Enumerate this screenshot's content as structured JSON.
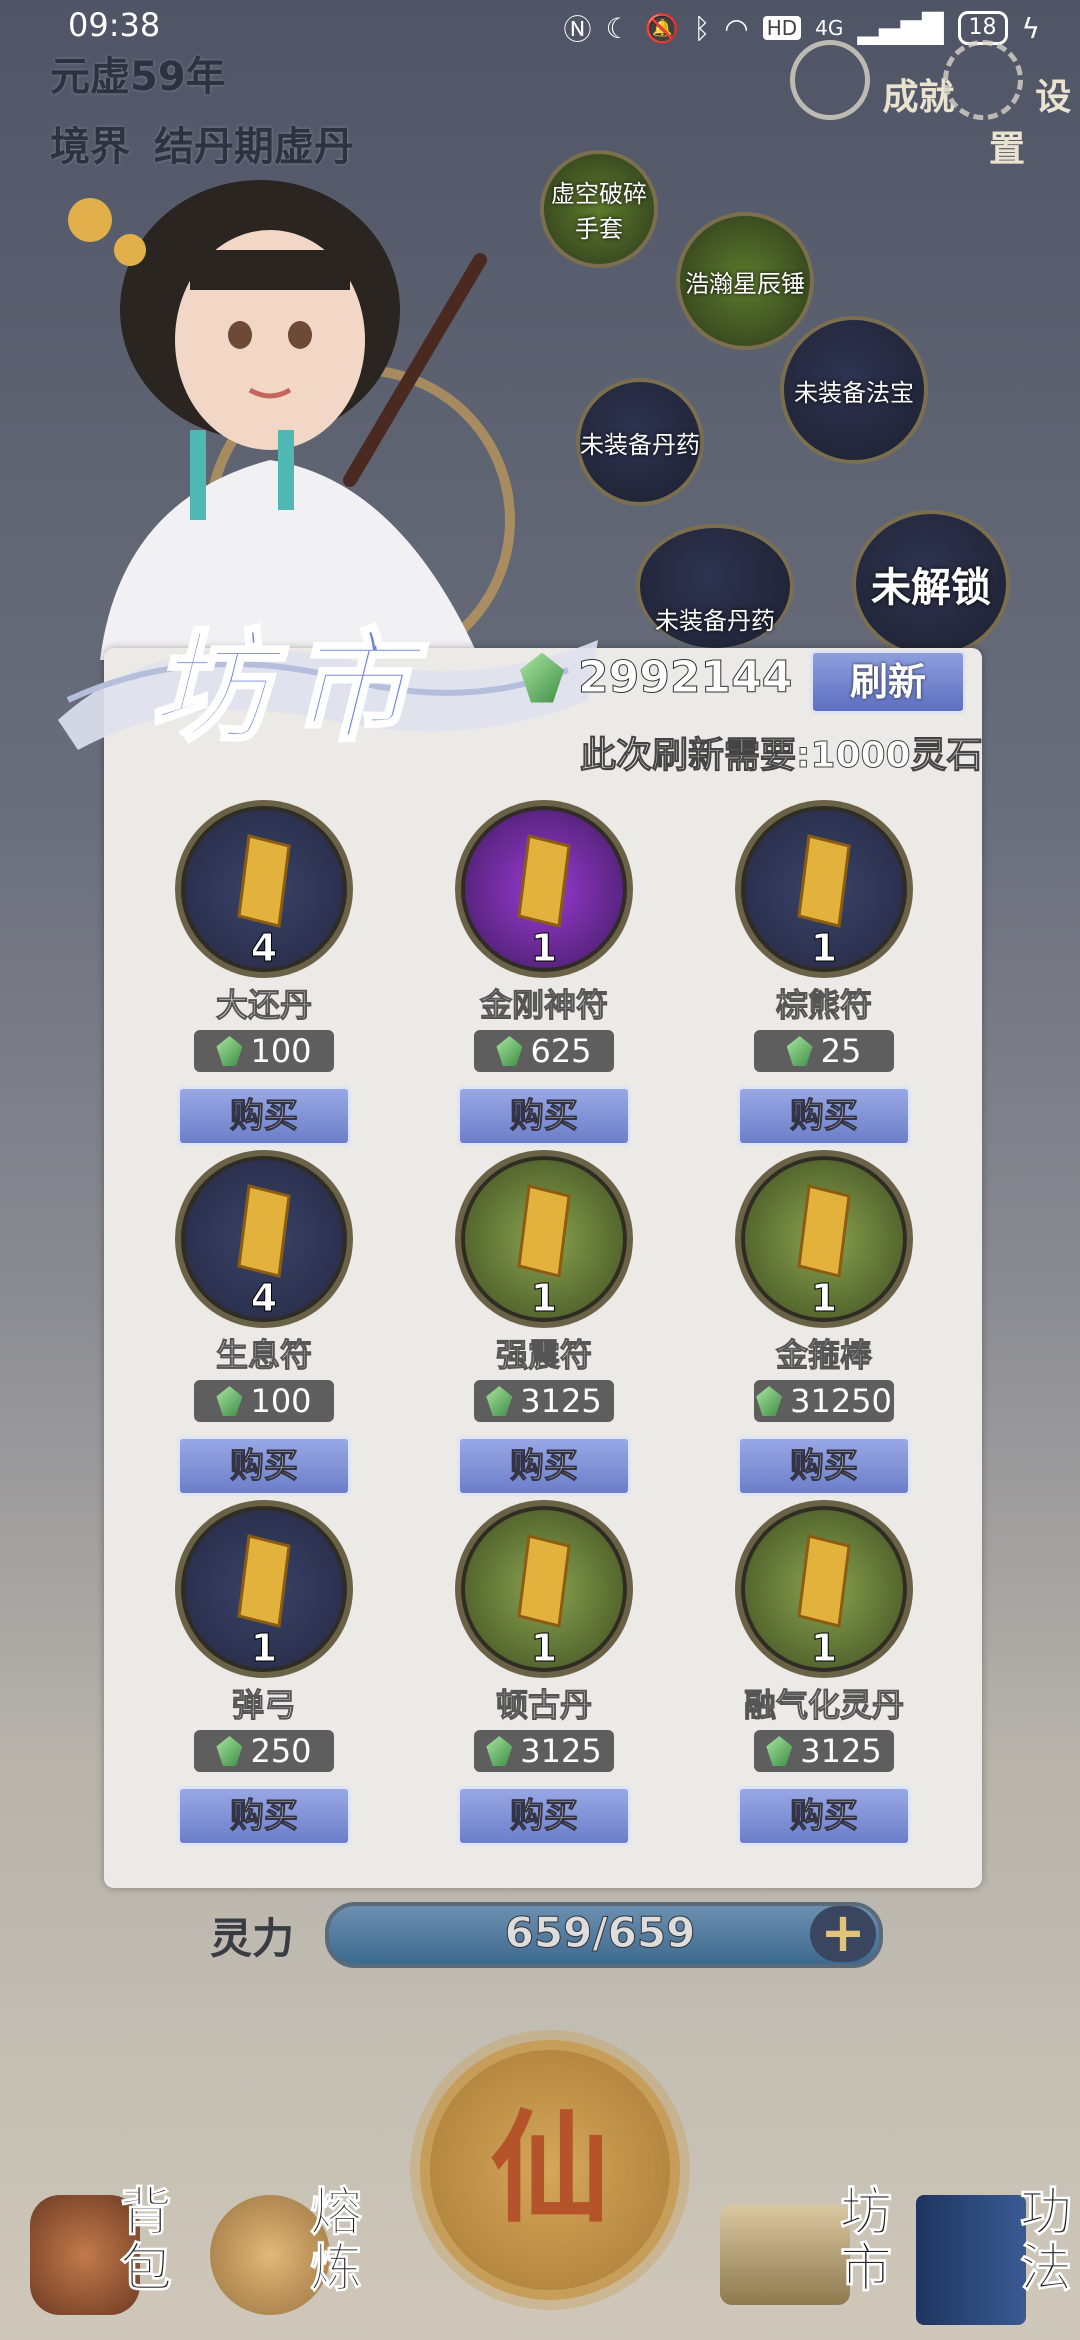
{
  "status_bar": {
    "time": "09:38",
    "network": "4G",
    "battery": "18"
  },
  "header": {
    "year": "元虚59年",
    "realm_label": "境界",
    "realm_value": "结丹期虚丹"
  },
  "top_buttons": {
    "achievements": "成就",
    "settings": "设置"
  },
  "equipment": [
    {
      "label": "虚空破碎手套"
    },
    {
      "label": "浩瀚星辰锤"
    },
    {
      "label": "未装备法宝"
    },
    {
      "label": "未装备丹药"
    },
    {
      "label": "未装备丹药"
    },
    {
      "label": "未解锁"
    }
  ],
  "market": {
    "title": "坊市",
    "spirit_stones": "2992144",
    "refresh_label": "刷新",
    "refresh_cost": "此次刷新需要:1000灵石",
    "buy_label": "购买",
    "items": [
      {
        "name": "大还丹",
        "qty": "4",
        "price": "100",
        "bg": "blue"
      },
      {
        "name": "金刚神符",
        "qty": "1",
        "price": "625",
        "bg": "purple"
      },
      {
        "name": "棕熊符",
        "qty": "1",
        "price": "25",
        "bg": "blue"
      },
      {
        "name": "生息符",
        "qty": "4",
        "price": "100",
        "bg": "blue"
      },
      {
        "name": "强震符",
        "qty": "1",
        "price": "3125",
        "bg": "green"
      },
      {
        "name": "金箍棒",
        "qty": "1",
        "price": "31250",
        "bg": "green"
      },
      {
        "name": "弹弓",
        "qty": "1",
        "price": "250",
        "bg": "blue"
      },
      {
        "name": "顿古丹",
        "qty": "1",
        "price": "3125",
        "bg": "green"
      },
      {
        "name": "融气化灵丹",
        "qty": "1",
        "price": "3125",
        "bg": "green"
      }
    ]
  },
  "spirit": {
    "label": "灵力",
    "value": "659/659",
    "plus": "+"
  },
  "bottom_nav": {
    "center": "仙",
    "bag": [
      "背",
      "包"
    ],
    "refine": [
      "熔",
      "炼"
    ],
    "market": [
      "坊",
      "市"
    ],
    "skills": [
      "功",
      "法"
    ]
  },
  "colors": {
    "accent": "#7083c9",
    "panel": "#eceae6",
    "gold": "#c79d5a"
  }
}
